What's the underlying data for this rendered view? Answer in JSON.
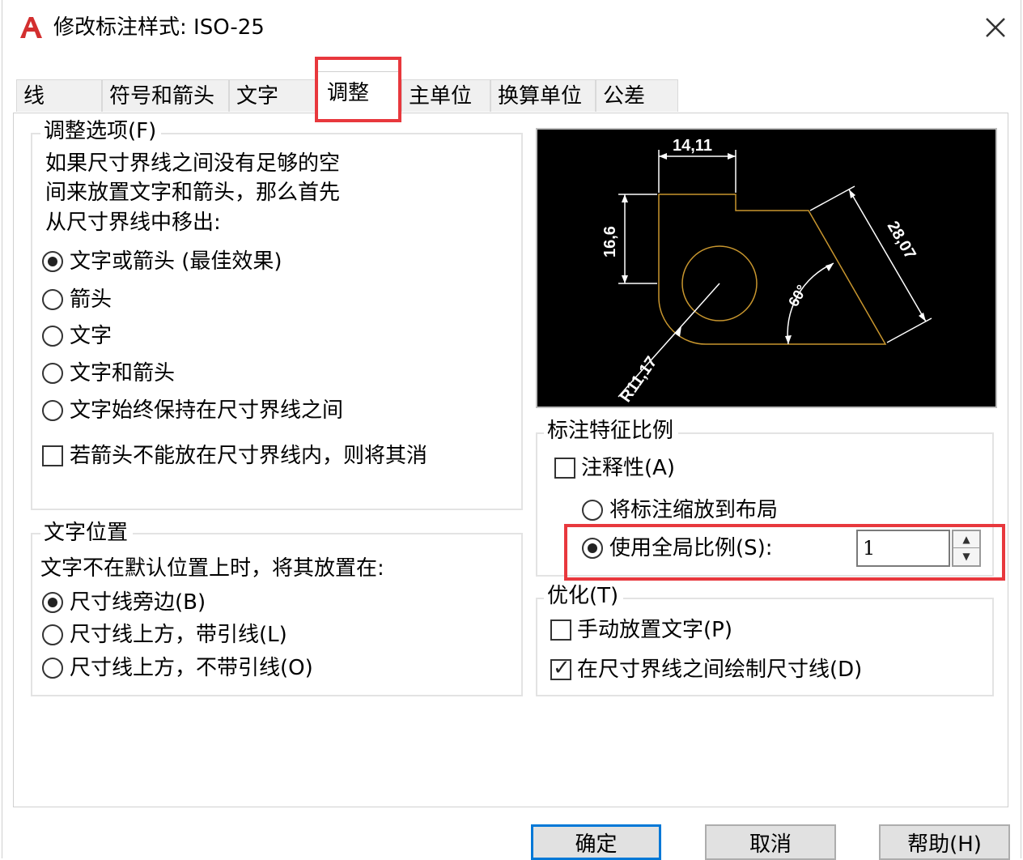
{
  "window": {
    "title": "修改标注样式: ISO-25",
    "app_icon": "autocad-logo-icon",
    "close_icon": "close-icon"
  },
  "tabs": [
    {
      "label": "线",
      "active": false
    },
    {
      "label": "符号和箭头",
      "active": false
    },
    {
      "label": "文字",
      "active": false
    },
    {
      "label": "调整",
      "active": true
    },
    {
      "label": "主单位",
      "active": false
    },
    {
      "label": "换算单位",
      "active": false
    },
    {
      "label": "公差",
      "active": false
    }
  ],
  "fit_options": {
    "legend": "调整选项(F)",
    "description": [
      "如果尺寸界线之间没有足够的空",
      "间来放置文字和箭头，那么首先",
      "从尺寸界线中移出:"
    ],
    "radios": [
      {
        "label": "文字或箭头 (最佳效果)",
        "selected": true
      },
      {
        "label": "箭头",
        "selected": false
      },
      {
        "label": "文字",
        "selected": false
      },
      {
        "label": "文字和箭头",
        "selected": false
      },
      {
        "label": "文字始终保持在尺寸界线之间",
        "selected": false
      }
    ],
    "suppress_checkbox": {
      "label": "若箭头不能放在尺寸界线内，则将其消",
      "checked": false
    }
  },
  "text_placement": {
    "legend": "文字位置",
    "description": "文字不在默认位置上时，将其放置在:",
    "radios": [
      {
        "label": "尺寸线旁边(B)",
        "selected": true
      },
      {
        "label": "尺寸线上方，带引线(L)",
        "selected": false
      },
      {
        "label": "尺寸线上方，不带引线(O)",
        "selected": false
      }
    ]
  },
  "preview": {
    "dim_top": "14,11",
    "dim_left": "16,6",
    "dim_right": "28,07",
    "dim_angle": "60°",
    "dim_radius": "R11,17",
    "geometry_color": "#c8962e",
    "dim_color": "#ffffff"
  },
  "scale": {
    "legend": "标注特征比例",
    "annotative": {
      "label": "注释性(A)",
      "checked": false
    },
    "scale_to_layout": {
      "label": "将标注缩放到布局",
      "selected": false
    },
    "use_overall": {
      "label": "使用全局比例(S):",
      "selected": true
    },
    "overall_value": "1",
    "spin_up_icon": "spin-up-icon",
    "spin_down_icon": "spin-down-icon"
  },
  "fine_tuning": {
    "legend": "优化(T)",
    "manual_place": {
      "label": "手动放置文字(P)",
      "checked": false
    },
    "draw_dim_line": {
      "label": "在尺寸界线之间绘制尺寸线(D)",
      "checked": true
    }
  },
  "buttons": {
    "ok": "确定",
    "cancel": "取消",
    "help": "帮助(H)"
  },
  "colors": {
    "highlight": "#e8383d",
    "default_button_border": "#0078d7",
    "logo_red": "#d32f2f"
  }
}
